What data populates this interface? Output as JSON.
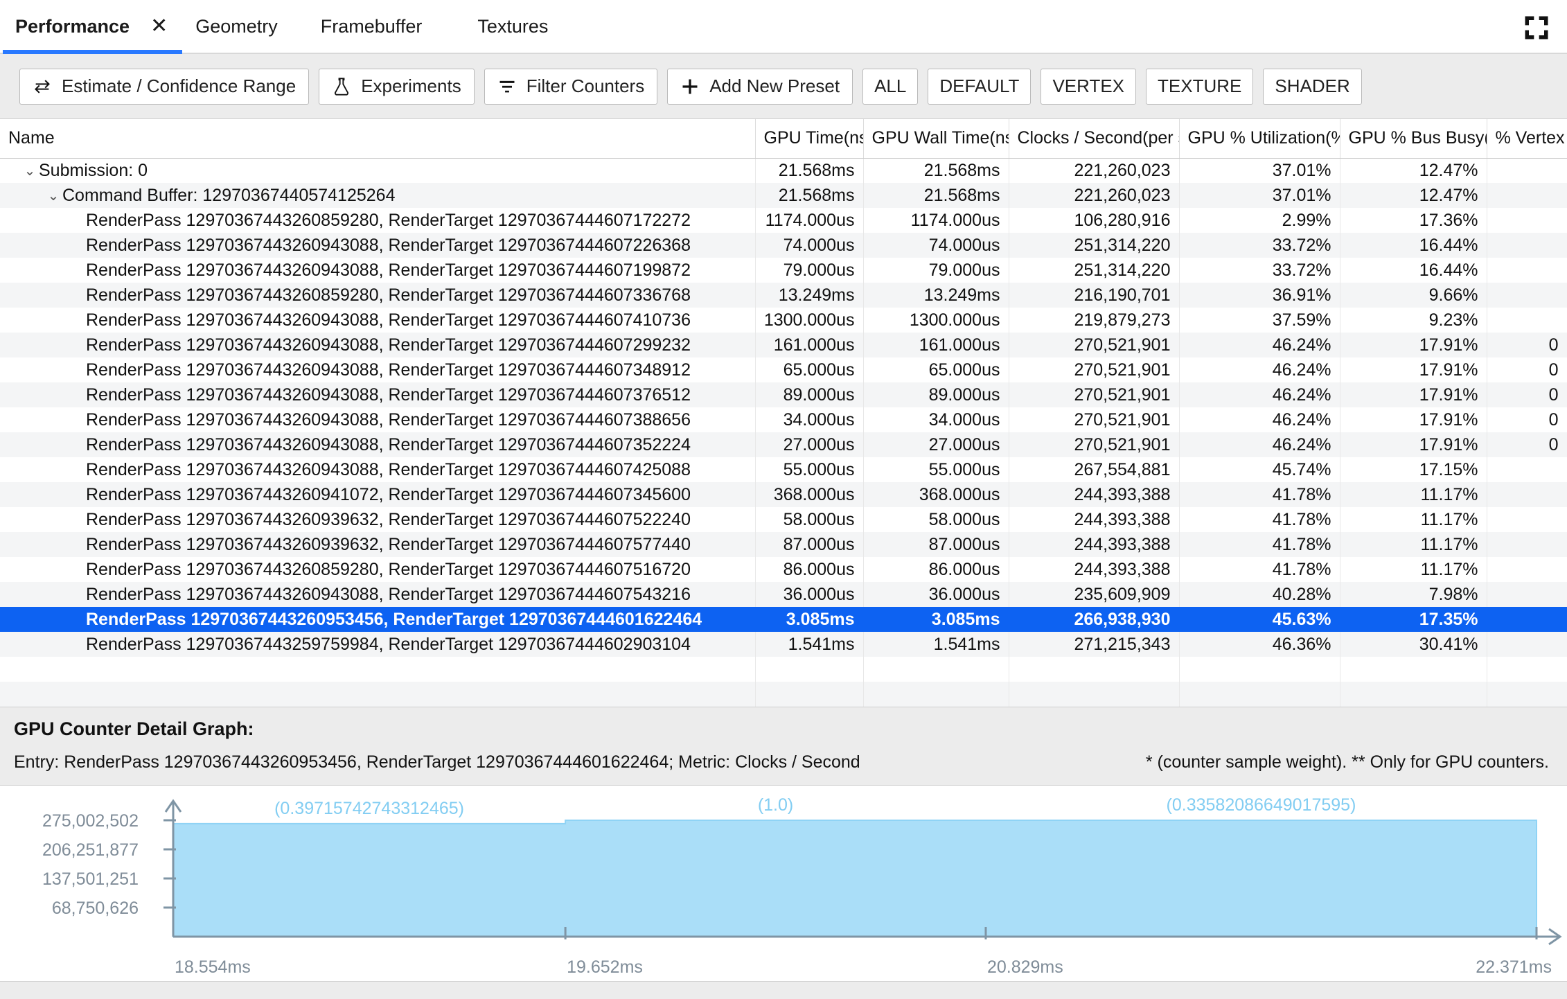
{
  "tabs": [
    {
      "label": "Performance",
      "active": true,
      "closable": true
    },
    {
      "label": "Geometry",
      "active": false,
      "closable": false
    },
    {
      "label": "Framebuffer",
      "active": false,
      "closable": false
    },
    {
      "label": "Textures",
      "active": false,
      "closable": false
    }
  ],
  "tab_close_glyph": "✕",
  "toolbar": {
    "buttons": [
      {
        "label": "Estimate / Confidence Range",
        "icon": "swap-arrows-icon"
      },
      {
        "label": "Experiments",
        "icon": "flask-icon"
      },
      {
        "label": "Filter Counters",
        "icon": "filter-icon"
      },
      {
        "label": "Add New Preset",
        "icon": "plus-icon"
      }
    ],
    "presets": [
      "ALL",
      "DEFAULT",
      "VERTEX",
      "TEXTURE",
      "SHADER"
    ]
  },
  "table": {
    "columns": [
      "Name",
      "GPU Time(ns)",
      "GPU Wall Time(ns)",
      "Clocks / Second(per s)",
      "GPU % Utilization(%)",
      "GPU % Bus Busy(%)",
      "% Vertex"
    ],
    "rows": [
      {
        "indent": 0,
        "chevron": "⌄",
        "name": "Submission: 0",
        "gpu_time": "21.568ms",
        "gpu_wall_time": "21.568ms",
        "clocks": "221,260,023",
        "utilization": "37.01%",
        "bus_busy": "12.47%",
        "vertex": "",
        "selected": false
      },
      {
        "indent": 1,
        "chevron": "⌄",
        "name": "Command Buffer: 12970367440574125264",
        "gpu_time": "21.568ms",
        "gpu_wall_time": "21.568ms",
        "clocks": "221,260,023",
        "utilization": "37.01%",
        "bus_busy": "12.47%",
        "vertex": "",
        "selected": false
      },
      {
        "indent": 2,
        "chevron": "",
        "name": "RenderPass 12970367443260859280, RenderTarget 12970367444607172272",
        "gpu_time": "1174.000us",
        "gpu_wall_time": "1174.000us",
        "clocks": "106,280,916",
        "utilization": "2.99%",
        "bus_busy": "17.36%",
        "vertex": "",
        "selected": false
      },
      {
        "indent": 2,
        "chevron": "",
        "name": "RenderPass 12970367443260943088, RenderTarget 12970367444607226368",
        "gpu_time": "74.000us",
        "gpu_wall_time": "74.000us",
        "clocks": "251,314,220",
        "utilization": "33.72%",
        "bus_busy": "16.44%",
        "vertex": "",
        "selected": false
      },
      {
        "indent": 2,
        "chevron": "",
        "name": "RenderPass 12970367443260943088, RenderTarget 12970367444607199872",
        "gpu_time": "79.000us",
        "gpu_wall_time": "79.000us",
        "clocks": "251,314,220",
        "utilization": "33.72%",
        "bus_busy": "16.44%",
        "vertex": "",
        "selected": false
      },
      {
        "indent": 2,
        "chevron": "",
        "name": "RenderPass 12970367443260859280, RenderTarget 12970367444607336768",
        "gpu_time": "13.249ms",
        "gpu_wall_time": "13.249ms",
        "clocks": "216,190,701",
        "utilization": "36.91%",
        "bus_busy": "9.66%",
        "vertex": "",
        "selected": false
      },
      {
        "indent": 2,
        "chevron": "",
        "name": "RenderPass 12970367443260943088, RenderTarget 12970367444607410736",
        "gpu_time": "1300.000us",
        "gpu_wall_time": "1300.000us",
        "clocks": "219,879,273",
        "utilization": "37.59%",
        "bus_busy": "9.23%",
        "vertex": "",
        "selected": false
      },
      {
        "indent": 2,
        "chevron": "",
        "name": "RenderPass 12970367443260943088, RenderTarget 12970367444607299232",
        "gpu_time": "161.000us",
        "gpu_wall_time": "161.000us",
        "clocks": "270,521,901",
        "utilization": "46.24%",
        "bus_busy": "17.91%",
        "vertex": "0",
        "selected": false
      },
      {
        "indent": 2,
        "chevron": "",
        "name": "RenderPass 12970367443260943088, RenderTarget 12970367444607348912",
        "gpu_time": "65.000us",
        "gpu_wall_time": "65.000us",
        "clocks": "270,521,901",
        "utilization": "46.24%",
        "bus_busy": "17.91%",
        "vertex": "0",
        "selected": false
      },
      {
        "indent": 2,
        "chevron": "",
        "name": "RenderPass 12970367443260943088, RenderTarget 12970367444607376512",
        "gpu_time": "89.000us",
        "gpu_wall_time": "89.000us",
        "clocks": "270,521,901",
        "utilization": "46.24%",
        "bus_busy": "17.91%",
        "vertex": "0",
        "selected": false
      },
      {
        "indent": 2,
        "chevron": "",
        "name": "RenderPass 12970367443260943088, RenderTarget 12970367444607388656",
        "gpu_time": "34.000us",
        "gpu_wall_time": "34.000us",
        "clocks": "270,521,901",
        "utilization": "46.24%",
        "bus_busy": "17.91%",
        "vertex": "0",
        "selected": false
      },
      {
        "indent": 2,
        "chevron": "",
        "name": "RenderPass 12970367443260943088, RenderTarget 12970367444607352224",
        "gpu_time": "27.000us",
        "gpu_wall_time": "27.000us",
        "clocks": "270,521,901",
        "utilization": "46.24%",
        "bus_busy": "17.91%",
        "vertex": "0",
        "selected": false
      },
      {
        "indent": 2,
        "chevron": "",
        "name": "RenderPass 12970367443260943088, RenderTarget 12970367444607425088",
        "gpu_time": "55.000us",
        "gpu_wall_time": "55.000us",
        "clocks": "267,554,881",
        "utilization": "45.74%",
        "bus_busy": "17.15%",
        "vertex": "",
        "selected": false
      },
      {
        "indent": 2,
        "chevron": "",
        "name": "RenderPass 12970367443260941072, RenderTarget 12970367444607345600",
        "gpu_time": "368.000us",
        "gpu_wall_time": "368.000us",
        "clocks": "244,393,388",
        "utilization": "41.78%",
        "bus_busy": "11.17%",
        "vertex": "",
        "selected": false
      },
      {
        "indent": 2,
        "chevron": "",
        "name": "RenderPass 12970367443260939632, RenderTarget 12970367444607522240",
        "gpu_time": "58.000us",
        "gpu_wall_time": "58.000us",
        "clocks": "244,393,388",
        "utilization": "41.78%",
        "bus_busy": "11.17%",
        "vertex": "",
        "selected": false
      },
      {
        "indent": 2,
        "chevron": "",
        "name": "RenderPass 12970367443260939632, RenderTarget 12970367444607577440",
        "gpu_time": "87.000us",
        "gpu_wall_time": "87.000us",
        "clocks": "244,393,388",
        "utilization": "41.78%",
        "bus_busy": "11.17%",
        "vertex": "",
        "selected": false
      },
      {
        "indent": 2,
        "chevron": "",
        "name": "RenderPass 12970367443260859280, RenderTarget 12970367444607516720",
        "gpu_time": "86.000us",
        "gpu_wall_time": "86.000us",
        "clocks": "244,393,388",
        "utilization": "41.78%",
        "bus_busy": "11.17%",
        "vertex": "",
        "selected": false
      },
      {
        "indent": 2,
        "chevron": "",
        "name": "RenderPass 12970367443260943088, RenderTarget 12970367444607543216",
        "gpu_time": "36.000us",
        "gpu_wall_time": "36.000us",
        "clocks": "235,609,909",
        "utilization": "40.28%",
        "bus_busy": "7.98%",
        "vertex": "",
        "selected": false
      },
      {
        "indent": 2,
        "chevron": "",
        "name": "RenderPass 12970367443260953456, RenderTarget 12970367444601622464",
        "gpu_time": "3.085ms",
        "gpu_wall_time": "3.085ms",
        "clocks": "266,938,930",
        "utilization": "45.63%",
        "bus_busy": "17.35%",
        "vertex": "",
        "selected": true
      },
      {
        "indent": 2,
        "chevron": "",
        "name": "RenderPass 12970367443259759984, RenderTarget 12970367444602903104",
        "gpu_time": "1.541ms",
        "gpu_wall_time": "1.541ms",
        "clocks": "271,215,343",
        "utilization": "46.36%",
        "bus_busy": "30.41%",
        "vertex": "",
        "selected": false
      }
    ],
    "blank_rows": 2
  },
  "detail": {
    "title": "GPU Counter Detail Graph:",
    "entry": "Entry: RenderPass 12970367443260953456, RenderTarget 12970367444601622464; Metric: Clocks / Second",
    "note": "* (counter sample weight). ** Only for GPU counters."
  },
  "chart_data": {
    "type": "area",
    "title": "GPU Counter Detail Graph",
    "metric": "Clocks / Second",
    "xlabel": "",
    "ylabel": "",
    "grid": false,
    "legend": "none",
    "y_ticks": [
      "275,002,502",
      "206,251,877",
      "137,501,251",
      "68,750,626"
    ],
    "y_tick_values": [
      275002502,
      206251877,
      137501251,
      68750626
    ],
    "ylim": [
      0,
      275002502
    ],
    "x_ticks": [
      "18.554ms",
      "19.652ms",
      "20.829ms",
      "22.371ms"
    ],
    "x_tick_values": [
      18.554,
      19.652,
      20.829,
      22.371
    ],
    "xlim": [
      18.554,
      22.371
    ],
    "segment_labels": [
      "(0.39715742743312465)",
      "(1.0)",
      "(0.33582086649017595)"
    ],
    "segments": [
      {
        "x_start": 18.554,
        "x_end": 19.652,
        "weight": 0.39715742743312465,
        "value": 266938930,
        "label": "(0.39715742743312465)"
      },
      {
        "x_start": 19.652,
        "x_end": 20.829,
        "weight": 1.0,
        "value": 275002502,
        "label": "(1.0)"
      },
      {
        "x_start": 20.829,
        "x_end": 22.371,
        "weight": 0.33582086649017595,
        "value": 275002502,
        "label": "(0.33582086649017595)"
      }
    ],
    "series": [
      {
        "name": "Clocks / Second",
        "x": [
          18.554,
          19.652,
          19.652,
          22.371
        ],
        "values": [
          266938930,
          266938930,
          275002502,
          275002502
        ]
      }
    ],
    "colors": {
      "area_fill": "#aadef8",
      "area_stroke": "#8fd3f5",
      "label": "#82cdf2",
      "axis": "#7f95a5",
      "tick_text": "#7f8c98"
    }
  },
  "colors": {
    "accent": "#2979ff",
    "selection": "#0d62f2",
    "toolbar_bg": "#ececec",
    "row_alt": "#f4f5f6"
  }
}
